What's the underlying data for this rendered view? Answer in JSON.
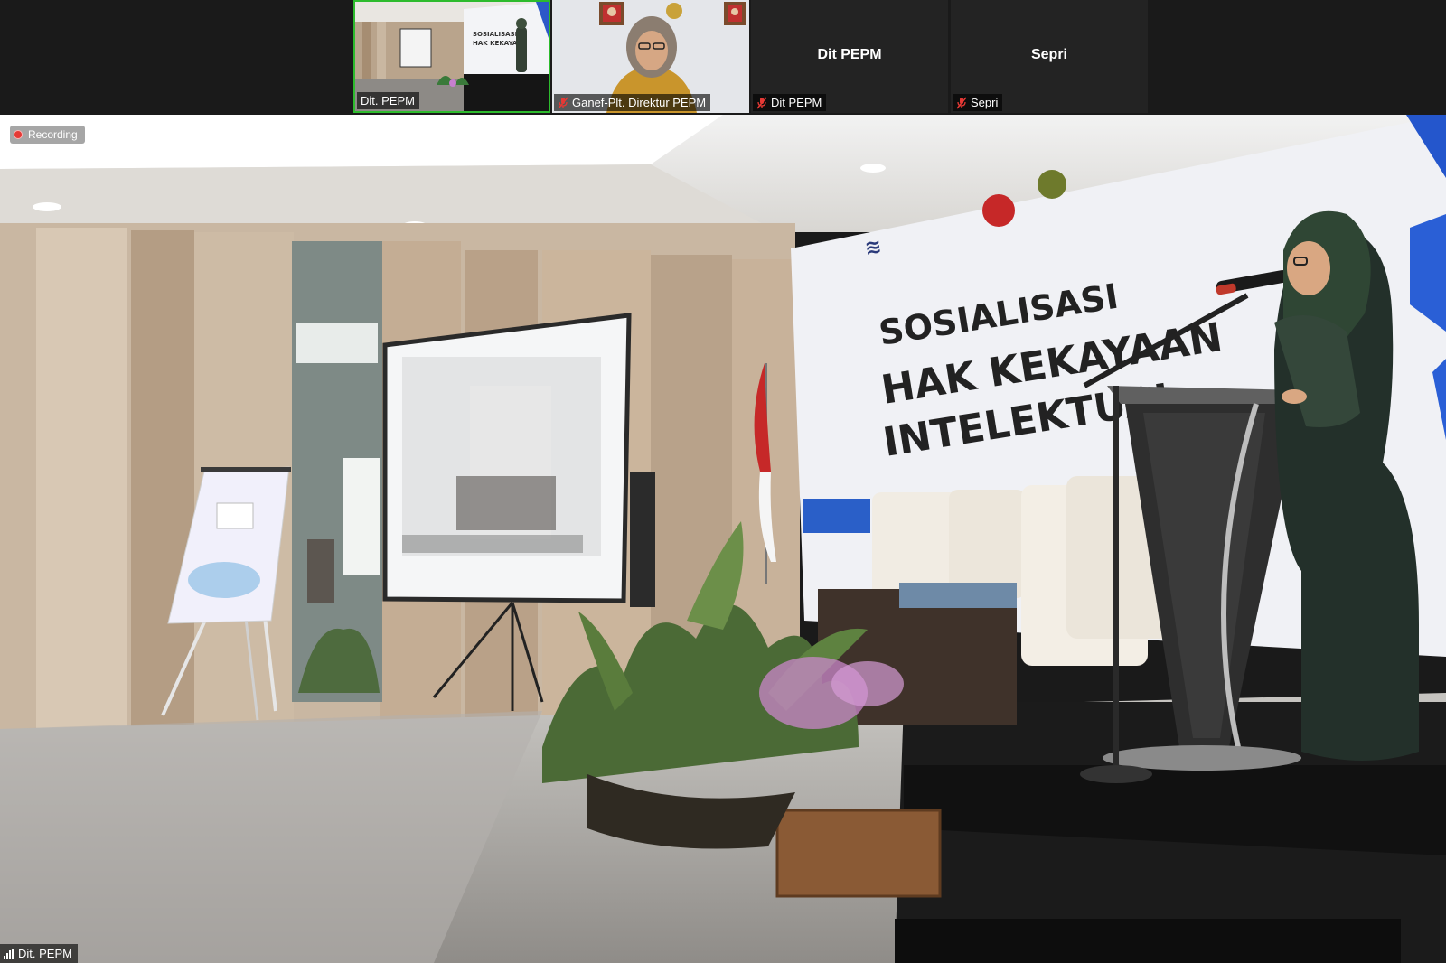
{
  "gallery": {
    "tiles": [
      {
        "name": "Dit. PEPM",
        "muted": false,
        "active": true,
        "has_video": true
      },
      {
        "name": "Ganef-Plt. Direktur PEPM",
        "muted": true,
        "active": false,
        "has_video": true
      },
      {
        "name": "Dit PEPM",
        "display_name": "Dit PEPM",
        "muted": true,
        "active": false,
        "has_video": false
      },
      {
        "name": "Sepri",
        "display_name": "Sepri",
        "muted": true,
        "active": false,
        "has_video": false
      }
    ]
  },
  "main_video": {
    "recording_label": "Recording",
    "speaker_label": "Dit. PEPM",
    "banner": {
      "line1": "SOSIALISASI",
      "line2": "HAK KEKAYAAN",
      "line3": "INTELEKTUAL"
    }
  },
  "icons": {
    "recording": "recording-dot-icon",
    "muted": "mic-muted-icon",
    "signal": "signal-strength-icon"
  },
  "colors": {
    "active_speaker_border": "#2dbb2d",
    "recording_dot": "#e53935",
    "muted_icon": "#e53935",
    "background": "#1a1a1a"
  }
}
